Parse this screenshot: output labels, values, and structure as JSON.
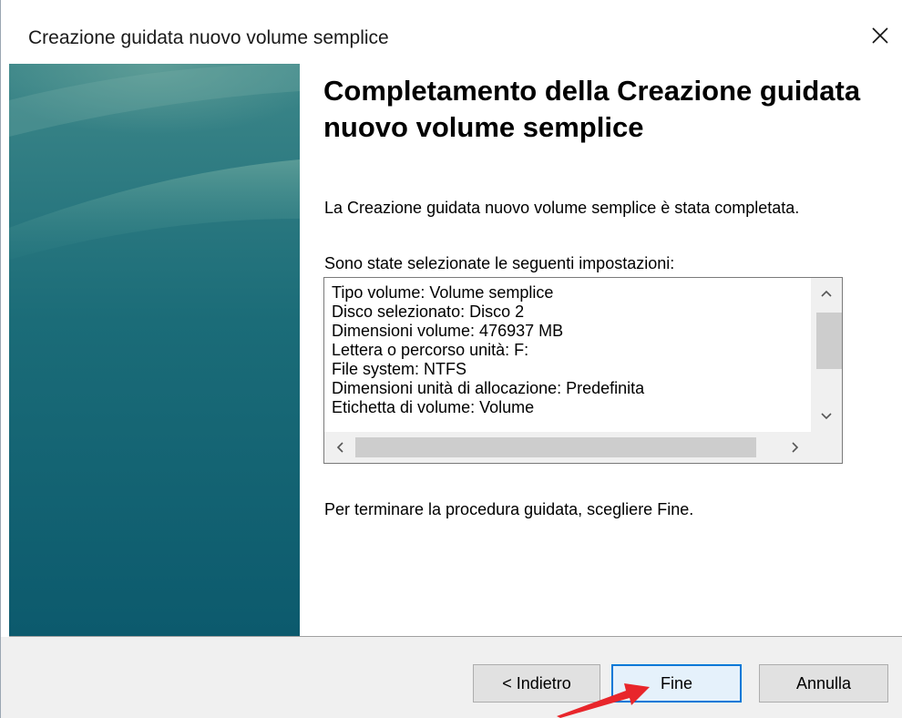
{
  "window": {
    "title": "Creazione guidata nuovo volume semplice"
  },
  "content": {
    "heading": "Completamento della Creazione guidata nuovo volume semplice",
    "description": "La Creazione guidata nuovo volume semplice è stata completata.",
    "settings_label": "Sono state selezionate le seguenti impostazioni:",
    "settings": [
      "Tipo volume: Volume semplice",
      "Disco selezionato: Disco 2",
      "Dimensioni volume: 476937 MB",
      "Lettera o percorso unità: F:",
      "File system: NTFS",
      "Dimensioni unità di allocazione: Predefinita",
      "Etichetta di volume: Volume"
    ],
    "finish_instruction": "Per terminare la procedura guidata, scegliere Fine."
  },
  "footer": {
    "back_label": "< Indietro",
    "finish_label": "Fine",
    "cancel_label": "Annulla"
  },
  "icons": {
    "close": "close-icon",
    "scroll_up": "chevron-up-icon",
    "scroll_down": "chevron-down-icon",
    "scroll_left": "chevron-left-icon",
    "scroll_right": "chevron-right-icon",
    "annotation": "red-arrow-icon"
  },
  "colors": {
    "accent": "#0078d7",
    "panel_dark": "#0b5c6b",
    "panel_light": "#2f7f84",
    "arrow": "#e8262b"
  }
}
